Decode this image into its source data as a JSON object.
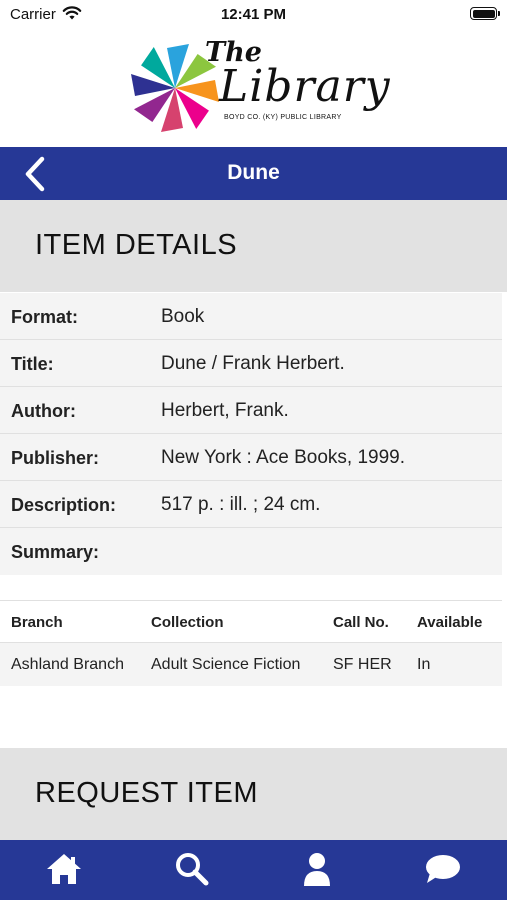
{
  "status_bar": {
    "carrier": "Carrier",
    "time": "12:41 PM"
  },
  "logo": {
    "the": "The",
    "library": "Library",
    "subtitle": "BOYD CO. (KY) PUBLIC LIBRARY"
  },
  "nav": {
    "title": "Dune",
    "back_icon": "chevron-left-icon"
  },
  "item_details": {
    "header": "ITEM DETAILS",
    "rows": [
      {
        "label": "Format:",
        "value": "Book"
      },
      {
        "label": "Title:",
        "value": "Dune / Frank Herbert."
      },
      {
        "label": "Author:",
        "value": "Herbert, Frank."
      },
      {
        "label": "Publisher:",
        "value": "New York : Ace Books, 1999."
      },
      {
        "label": "Description:",
        "value": "517 p. : ill. ; 24 cm."
      },
      {
        "label": "Summary:",
        "value": ""
      }
    ]
  },
  "holdings": {
    "columns": [
      "Branch",
      "Collection",
      "Call No.",
      "Available"
    ],
    "rows": [
      [
        "Ashland Branch",
        "Adult Science Fiction",
        "SF HER",
        "In"
      ]
    ]
  },
  "request": {
    "header": "REQUEST ITEM"
  },
  "tab_bar": {
    "tabs": [
      {
        "icon": "home-icon"
      },
      {
        "icon": "search-icon"
      },
      {
        "icon": "user-icon"
      },
      {
        "icon": "chat-bubble-icon"
      }
    ]
  },
  "colors": {
    "brand_blue": "#263896",
    "section_gray": "#e2e2e2",
    "row_bg": "#f4f4f4"
  }
}
